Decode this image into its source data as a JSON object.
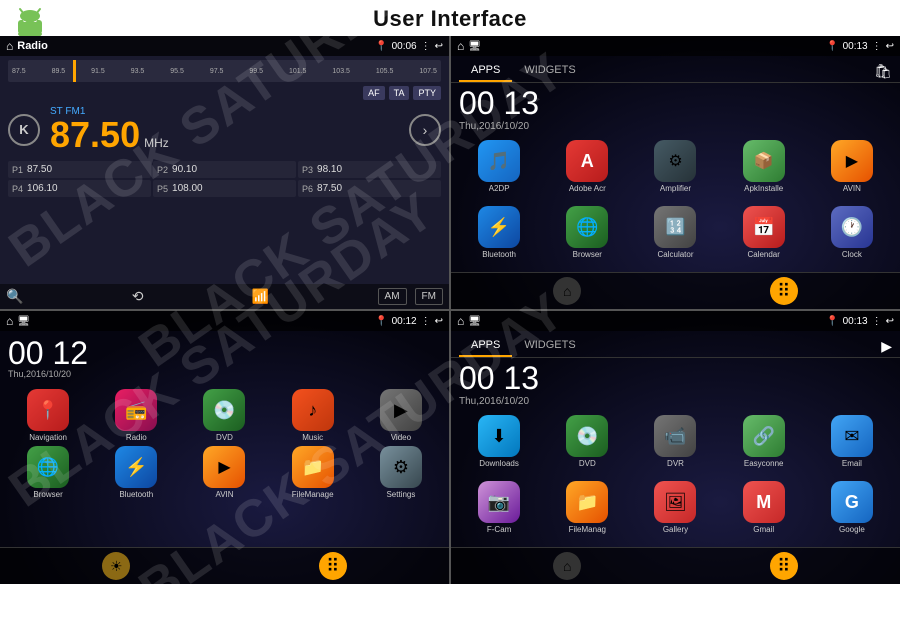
{
  "header": {
    "title": "User Interface"
  },
  "screen1": {
    "title": "Radio",
    "time": "00:06",
    "freq_scale": [
      "87.5",
      "89.5",
      "91.5",
      "93.5",
      "95.5",
      "97.5",
      "99.5",
      "101.5",
      "103.5",
      "105.5",
      "107.5"
    ],
    "buttons": [
      "AF",
      "TA",
      "PTY"
    ],
    "k_label": "K",
    "st_fm": "ST FM1",
    "frequency": "87.50",
    "mhz": "MHz",
    "presets": [
      {
        "label": "P1",
        "value": "87.50"
      },
      {
        "label": "P2",
        "value": "90.10"
      },
      {
        "label": "P3",
        "value": "98.10"
      },
      {
        "label": "P4",
        "value": "106.10"
      },
      {
        "label": "P5",
        "value": "108.00"
      },
      {
        "label": "P6",
        "value": "87.50"
      }
    ],
    "band_am": "AM",
    "band_fm": "FM"
  },
  "screen2": {
    "title": "Apps",
    "time": "00:13",
    "clock_time": "00 13",
    "date": "Thu,2016/10/20",
    "tab_apps": "APPS",
    "tab_widgets": "WIDGETS",
    "apps": [
      {
        "label": "A2DP",
        "icon": "ic-a2dp",
        "symbol": "🎵"
      },
      {
        "label": "Adobe Acr",
        "icon": "ic-adobe",
        "symbol": "A"
      },
      {
        "label": "Amplifier",
        "icon": "ic-amplifier",
        "symbol": "⚙"
      },
      {
        "label": "ApkInstalle",
        "icon": "ic-apkinstaller",
        "symbol": "📦"
      },
      {
        "label": "AVIN",
        "icon": "ic-avin",
        "symbol": "▶"
      },
      {
        "label": "Bluetooth",
        "icon": "ic-bluetooth",
        "symbol": "⚡"
      },
      {
        "label": "Browser",
        "icon": "ic-browser",
        "symbol": "🌐"
      },
      {
        "label": "Calculator",
        "icon": "ic-calculator",
        "symbol": "🔢"
      },
      {
        "label": "Calendar",
        "icon": "ic-calendar",
        "symbol": "📅"
      },
      {
        "label": "Clock",
        "icon": "ic-clock",
        "symbol": "🕐"
      }
    ]
  },
  "screen3": {
    "title": "Home",
    "time": "00:12",
    "clock_time": "00 12",
    "date": "Thu,2016/10/20",
    "apps": [
      {
        "label": "Navigation",
        "icon": "ic-navigation",
        "symbol": "📍"
      },
      {
        "label": "Radio",
        "icon": "ic-radio",
        "symbol": "📻"
      },
      {
        "label": "DVD",
        "icon": "ic-dvd",
        "symbol": "💿"
      },
      {
        "label": "Music",
        "icon": "ic-music",
        "symbol": "♪"
      },
      {
        "label": "Video",
        "icon": "ic-video",
        "symbol": "▶"
      },
      {
        "label": "Browser",
        "icon": "ic-browser",
        "symbol": "🌐"
      },
      {
        "label": "Bluetooth",
        "icon": "ic-bluetooth",
        "symbol": "⚡"
      },
      {
        "label": "AVIN",
        "icon": "ic-avin2",
        "symbol": "▶"
      },
      {
        "label": "FileManage",
        "icon": "ic-filemanager",
        "symbol": "📁"
      },
      {
        "label": "Settings",
        "icon": "ic-settings",
        "symbol": "⚙"
      }
    ]
  },
  "screen4": {
    "title": "Apps2",
    "time": "00:13",
    "clock_time": "00 13",
    "date": "Thu,2016/10/20",
    "tab_apps": "APPS",
    "tab_widgets": "WIDGETS",
    "apps": [
      {
        "label": "Downloads",
        "icon": "ic-downloads",
        "symbol": "⬇"
      },
      {
        "label": "DVD",
        "icon": "ic-dvd",
        "symbol": "💿"
      },
      {
        "label": "DVR",
        "icon": "ic-dvr",
        "symbol": "📹"
      },
      {
        "label": "Easyconne",
        "icon": "ic-easyconnect",
        "symbol": "🔗"
      },
      {
        "label": "Email",
        "icon": "ic-email",
        "symbol": "✉"
      },
      {
        "label": "F-Cam",
        "icon": "ic-fcam",
        "symbol": "📷"
      },
      {
        "label": "FileManag",
        "icon": "ic-filemanager",
        "symbol": "📁"
      },
      {
        "label": "Gallery",
        "icon": "ic-gallery",
        "symbol": "🖼"
      },
      {
        "label": "Gmail",
        "icon": "ic-gmail",
        "symbol": "M"
      },
      {
        "label": "Google",
        "icon": "ic-google",
        "symbol": "G"
      }
    ]
  },
  "watermarks": [
    "BLACK SATURDAY",
    "BLACK SATURDAY",
    "BLACK SATURDAY",
    "BLACK SATURDAY"
  ]
}
